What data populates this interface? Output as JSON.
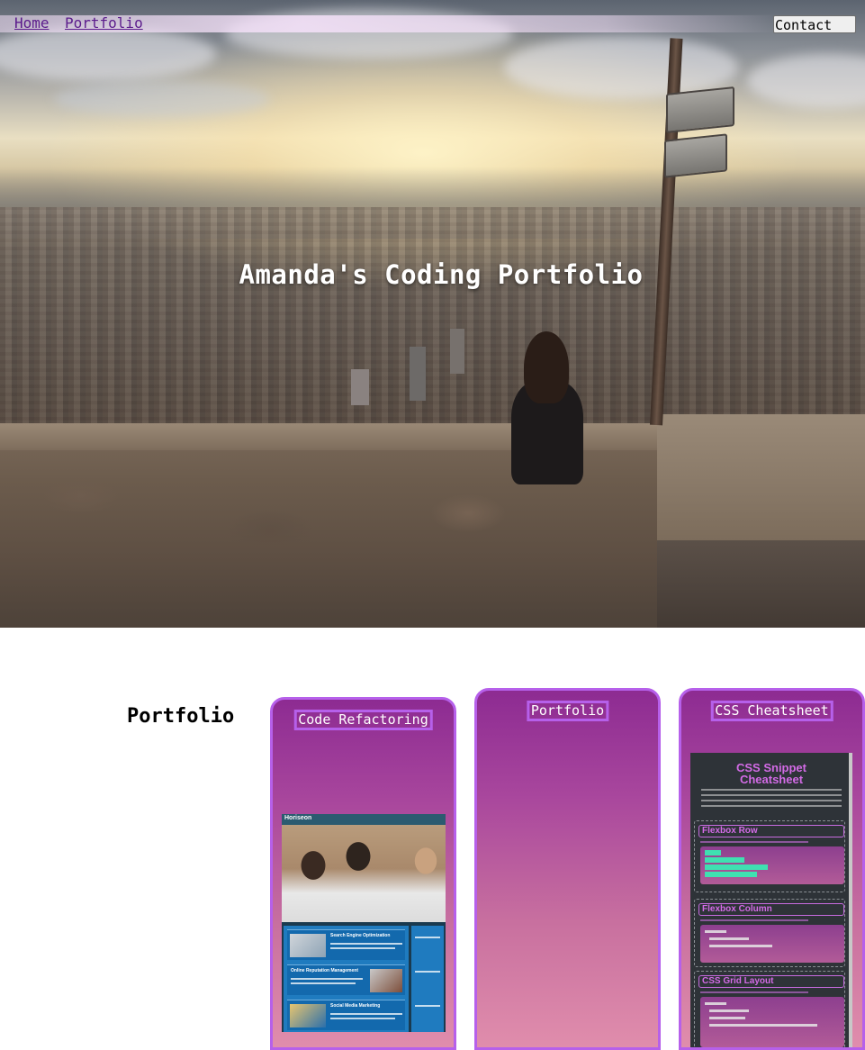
{
  "nav": {
    "links": [
      {
        "label": "Home"
      },
      {
        "label": "Portfolio"
      }
    ],
    "contact_button": "Contact Me"
  },
  "hero": {
    "title": "Amanda's Coding Portfolio"
  },
  "portfolio": {
    "heading": "Portfolio",
    "cards": [
      {
        "title": "Code Refactoring",
        "thumbnail": {
          "logo": "Horiseon",
          "sections": [
            "Search Engine Optimization",
            "Online Reputation Management",
            "Social Media Marketing"
          ]
        }
      },
      {
        "title": "Portfolio"
      },
      {
        "title": "CSS Cheatsheet",
        "thumbnail": {
          "heading_line1": "CSS Snippet",
          "heading_line2": "Cheatsheet",
          "sections": [
            "Flexbox Row",
            "Flexbox Column",
            "CSS Grid Layout"
          ]
        }
      }
    ]
  },
  "colors": {
    "accent_border": "#b660ea",
    "card_gradient_top": "#8d2b92",
    "card_gradient_bottom": "#e08dac",
    "nav_link": "#5b1b8c"
  }
}
